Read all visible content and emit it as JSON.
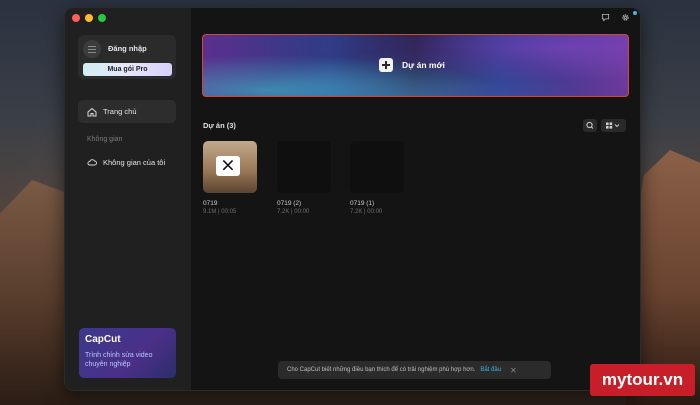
{
  "account": {
    "login_label": "Đăng nhập",
    "pro_button": "Mua gói Pro"
  },
  "sidebar": {
    "home": {
      "label": "Trang chủ",
      "icon": "home-icon"
    },
    "section_label": "Không gian",
    "space": {
      "label": "Không gian của tôi",
      "icon": "cloud-icon"
    }
  },
  "promo": {
    "title": "CapCut",
    "subtitle": "Trình chỉnh sửa video chuyên nghiệp"
  },
  "hero": {
    "new_project_label": "Dự án mới"
  },
  "projects": {
    "title": "Dự án  (3)",
    "items": [
      {
        "name": "0719",
        "meta": "9.1M | 00:05"
      },
      {
        "name": "0719 (2)",
        "meta": "7.2K | 00:00"
      },
      {
        "name": "0719 (1)",
        "meta": "7.2K | 00:00"
      }
    ]
  },
  "toast": {
    "text": "Cho CapCut biết những điều bạn thích để có trải nghiệm phù hợp hơn.",
    "link": "Bắt đầu",
    "close": "✕"
  },
  "watermark": {
    "text": "mytour.vn"
  },
  "colors": {
    "hero_border": "#d4482c",
    "link": "#3fb6e8",
    "notification": "#3fb6e8",
    "watermark_bg": "#c81e2a"
  }
}
